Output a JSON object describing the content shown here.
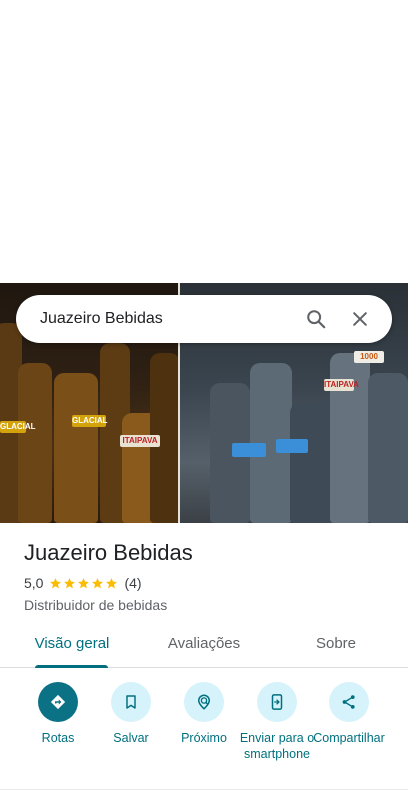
{
  "search": {
    "query": "Juazeiro Bebidas"
  },
  "photos": [
    {
      "name": "photo-left",
      "labels": [
        "GLACIAL",
        "GLACIAL",
        "ITAIPAVA"
      ]
    },
    {
      "name": "photo-right",
      "labels": [
        "ITAIPAVA",
        "1000"
      ]
    }
  ],
  "place": {
    "title": "Juazeiro Bebidas",
    "rating": "5,0",
    "stars": 5,
    "review_count": "(4)",
    "category": "Distribuidor de bebidas"
  },
  "tabs": [
    {
      "label": "Visão geral",
      "active": true
    },
    {
      "label": "Avaliações",
      "active": false
    },
    {
      "label": "Sobre",
      "active": false
    }
  ],
  "actions": [
    {
      "label": "Rotas",
      "icon": "directions-icon"
    },
    {
      "label": "Salvar",
      "icon": "bookmark-icon"
    },
    {
      "label": "Próximo",
      "icon": "nearby-icon"
    },
    {
      "label": "Enviar para o smartphone",
      "icon": "send-to-phone-icon"
    },
    {
      "label": "Compartilhar",
      "icon": "share-icon"
    }
  ],
  "colors": {
    "accent": "#00707f",
    "action_bg": "#d6f3fb",
    "primary_action": "#0b7285",
    "star": "#fbbc04"
  }
}
